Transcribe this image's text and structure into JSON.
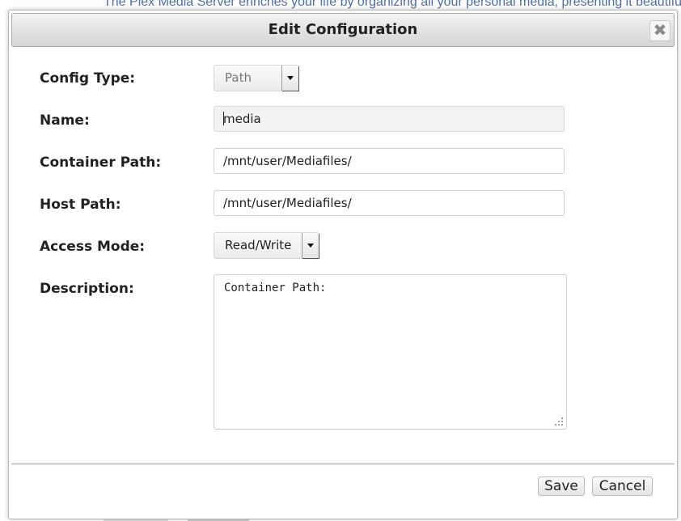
{
  "background": {
    "text": "The Plex Media Server enriches your life by organizing all your personal media, presenting it beautifully"
  },
  "dialog": {
    "title": "Edit Configuration",
    "close_icon": "close-icon",
    "fields": {
      "config_type": {
        "label": "Config Type:",
        "value": "Path"
      },
      "name": {
        "label": "Name:",
        "value": "media"
      },
      "container_path": {
        "label": "Container Path:",
        "value": "/mnt/user/Mediafiles/"
      },
      "host_path": {
        "label": "Host Path:",
        "value": "/mnt/user/Mediafiles/"
      },
      "access_mode": {
        "label": "Access Mode:",
        "value": "Read/Write"
      },
      "description": {
        "label": "Description:",
        "value": "Container Path:"
      }
    },
    "buttons": {
      "save": "Save",
      "cancel": "Cancel"
    }
  }
}
